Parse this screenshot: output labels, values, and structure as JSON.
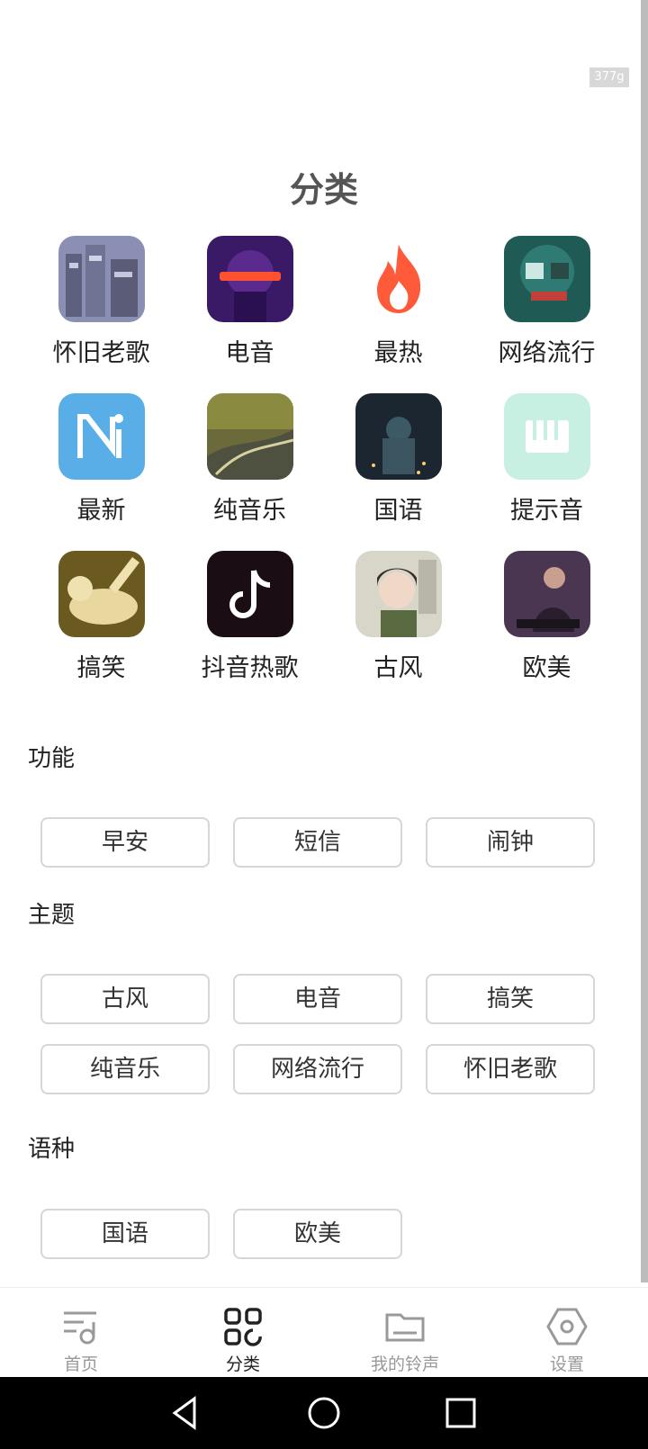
{
  "status": {
    "badge": "377g"
  },
  "title": "分类",
  "categories": [
    {
      "label": "怀旧老歌"
    },
    {
      "label": "电音"
    },
    {
      "label": "最热"
    },
    {
      "label": "网络流行"
    },
    {
      "label": "最新"
    },
    {
      "label": "纯音乐"
    },
    {
      "label": "国语"
    },
    {
      "label": "提示音"
    },
    {
      "label": "搞笑"
    },
    {
      "label": "抖音热歌"
    },
    {
      "label": "古风"
    },
    {
      "label": "欧美"
    }
  ],
  "sections": {
    "function": {
      "title": "功能",
      "chips": [
        "早安",
        "短信",
        "闹钟"
      ]
    },
    "theme": {
      "title": "主题",
      "chips": [
        "古风",
        "电音",
        "搞笑",
        "纯音乐",
        "网络流行",
        "怀旧老歌"
      ]
    },
    "language": {
      "title": "语种",
      "chips": [
        "国语",
        "欧美"
      ]
    }
  },
  "tabs": [
    {
      "label": "首页",
      "icon": "music-list-icon"
    },
    {
      "label": "分类",
      "icon": "grid-icon"
    },
    {
      "label": "我的铃声",
      "icon": "folder-icon"
    },
    {
      "label": "设置",
      "icon": "settings-hexagon-icon"
    }
  ],
  "colors": {
    "accent": "#222222",
    "inactive": "#999999"
  }
}
